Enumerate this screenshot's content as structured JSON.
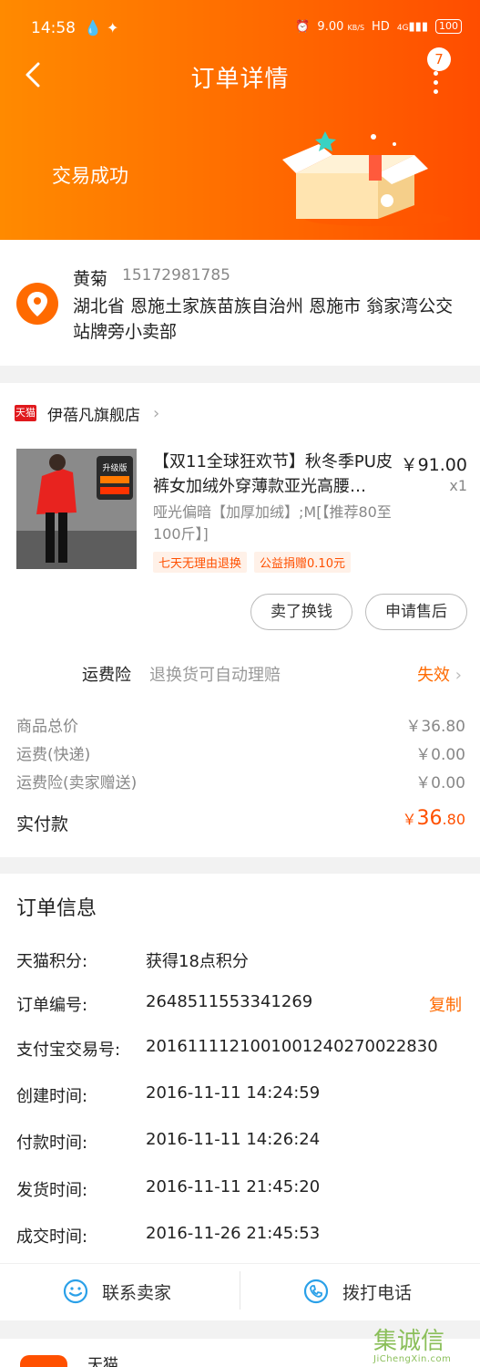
{
  "status_bar": {
    "time": "14:58",
    "speed": "9.00",
    "speed_unit": "KB/S",
    "network": "HD",
    "signal": "4G",
    "battery": "100"
  },
  "nav": {
    "title": "订单详情",
    "badge_count": "7"
  },
  "header": {
    "trade_status": "交易成功"
  },
  "address": {
    "name": "黄菊",
    "phone": "15172981785",
    "address": "湖北省 恩施土家族苗族自治州 恩施市 翁家湾公交站牌旁小卖部"
  },
  "shop": {
    "badge": "天猫",
    "name": "伊蓓凡旗舰店"
  },
  "product": {
    "title": "【双11全球狂欢节】秋冬季PU皮裤女加绒外穿薄款亚光高腰…",
    "price": "￥91.00",
    "qty": "x1",
    "sku": "哑光偏暗【加厚加绒】;M[【推荐80至100斤】]",
    "tags": [
      "七天无理由退换",
      "公益捐赠0.10元"
    ],
    "image_text": "升级版"
  },
  "actions": {
    "sell": "卖了换钱",
    "after_sale": "申请售后"
  },
  "insurance": {
    "label": "运费险",
    "desc": "退换货可自动理赔",
    "status": "失效"
  },
  "prices": {
    "goods_label": "商品总价",
    "goods_value": "￥36.80",
    "shipping_label": "运费(快递)",
    "shipping_value": "￥0.00",
    "ins_label": "运费险(卖家赠送)",
    "ins_value": "￥0.00",
    "paid_label": "实付款",
    "paid_symbol": "￥",
    "paid_int": "36",
    "paid_dec": ".80"
  },
  "order_info": {
    "title": "订单信息",
    "rows": [
      {
        "k": "天猫积分:",
        "v": "获得18点积分"
      },
      {
        "k": "订单编号:",
        "v": "2648511553341269",
        "action": "复制"
      },
      {
        "k": "支付宝交易号:",
        "v": "2016111121001001240270022830"
      },
      {
        "k": "创建时间:",
        "v": "2016-11-11 14:24:59"
      },
      {
        "k": "付款时间:",
        "v": "2016-11-11 14:26:24"
      },
      {
        "k": "发货时间:",
        "v": "2016-11-11 21:45:20"
      },
      {
        "k": "成交时间:",
        "v": "2016-11-26 21:45:53"
      }
    ]
  },
  "contact": {
    "seller": "联系卖家",
    "call": "拨打电话"
  },
  "next": {
    "label": "天猫"
  },
  "watermark": {
    "text": "集诚信",
    "url": "JiChengXin.com"
  },
  "colors": {
    "accent": "#ff6a00",
    "price_red": "#ff5000",
    "tmall_red": "#e0191d"
  }
}
